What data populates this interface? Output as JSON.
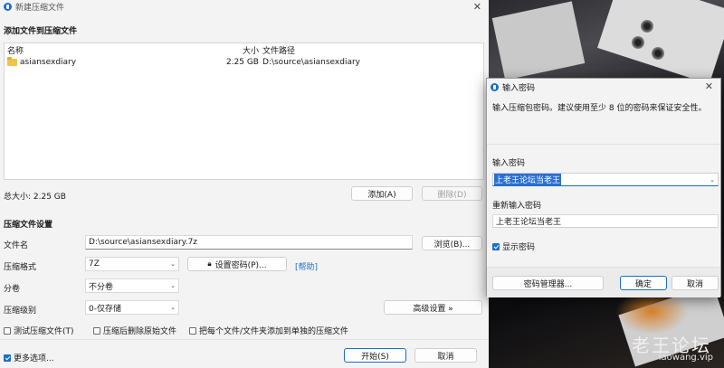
{
  "main": {
    "title": "新建压缩文件",
    "add_section": "添加文件到压缩文件",
    "columns": {
      "name": "名称",
      "size": "大小",
      "path": "文件路径"
    },
    "files": [
      {
        "name": "asiansexdiary",
        "size": "2.25 GB",
        "path": "D:\\source\\asiansexdiary"
      }
    ],
    "total": "总大小: 2.25 GB",
    "add_button": "添加(A)",
    "delete_button": "删除(D)",
    "settings_section": "压缩文件设置",
    "filename_label": "文件名",
    "filename_value": "D:\\source\\asiansexdiary.7z",
    "browse_button": "浏览(B)...",
    "format_label": "压缩格式",
    "format_value": "7Z",
    "set_password_button": "设置密码(P)...",
    "help_link": "[帮助]",
    "split_label": "分卷",
    "split_value": "不分卷",
    "level_label": "压缩级别",
    "level_value": "0-仅存储",
    "advanced_button": "高级设置 »",
    "opt_test": "测试压缩文件(T)",
    "opt_delete": "压缩后删除原始文件",
    "opt_separate": "把每个文件/文件夹添加到单独的压缩文件",
    "more_options": "更多选项...",
    "start_button": "开始(S)",
    "cancel_button": "取消"
  },
  "dialog": {
    "title": "输入密码",
    "description": "输入压缩包密码。建议使用至少 8 位的密码来保证安全性。",
    "password_label": "输入密码",
    "password_value": "上老王论坛当老王",
    "confirm_label": "重新输入密码",
    "confirm_value": "上老王论坛当老王",
    "show_password": "显示密码",
    "manager_button": "密码管理器...",
    "ok_button": "确定",
    "cancel_button": "取消"
  },
  "watermark": {
    "text": "老王论坛",
    "url": "laowang.vip"
  },
  "colors": {
    "accent": "#1b6fc9",
    "selection": "#2a6fd6"
  }
}
